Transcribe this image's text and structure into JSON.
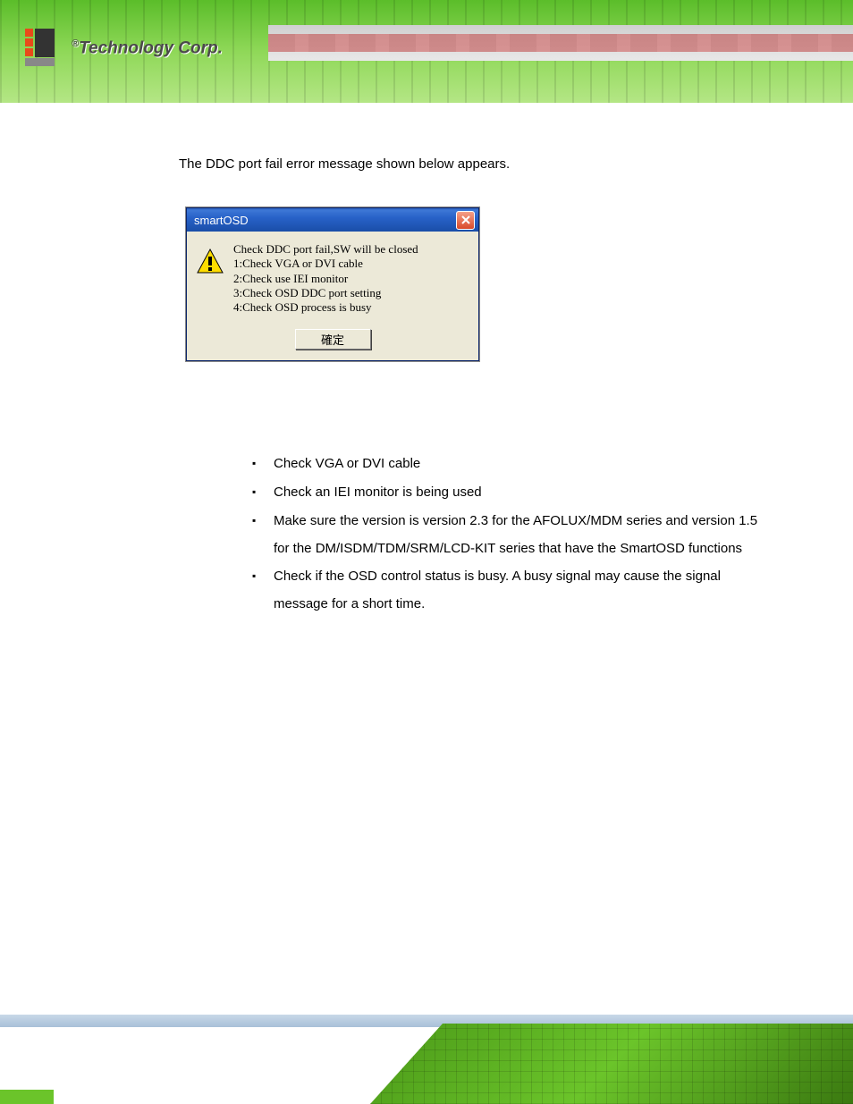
{
  "header": {
    "logo_text": "Technology Corp.",
    "logo_registered": "®"
  },
  "content": {
    "intro": "The DDC port fail error message shown below appears."
  },
  "dialog": {
    "title": "smartOSD",
    "line1": "Check DDC port fail,SW will be closed",
    "line2": "1:Check VGA or DVI cable",
    "line3": "2:Check use IEI monitor",
    "line4": "3:Check OSD DDC port setting",
    "line5": "4:Check OSD process is busy",
    "button": "確定"
  },
  "bullets": {
    "0": "Check VGA or DVI cable",
    "1": "Check an IEI monitor is being used",
    "2": "Make sure the version is version 2.3 for the AFOLUX/MDM series and version 1.5 for the DM/ISDM/TDM/SRM/LCD-KIT series that have the SmartOSD functions",
    "3": "Check if the OSD control status is busy. A busy signal may cause the signal message for a short time."
  }
}
